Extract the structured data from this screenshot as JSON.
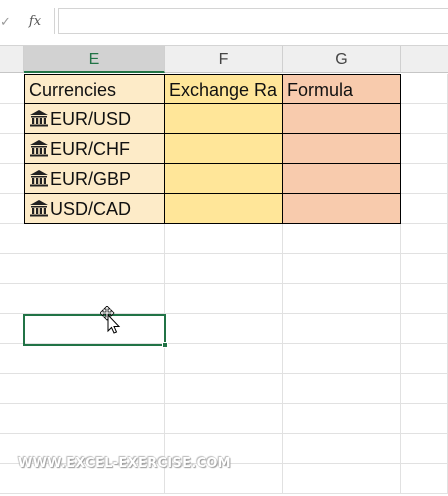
{
  "formula_bar": {
    "fx_label": "fx",
    "check_label": "✓",
    "value": ""
  },
  "columns": [
    "E",
    "F",
    "G"
  ],
  "selected_column": "E",
  "table": {
    "headers": [
      "Currencies",
      "Exchange Ra",
      "Formula"
    ],
    "rows": [
      {
        "currency": "EUR/USD",
        "rate": "",
        "formula": ""
      },
      {
        "currency": "EUR/CHF",
        "rate": "",
        "formula": ""
      },
      {
        "currency": "EUR/GBP",
        "rate": "",
        "formula": ""
      },
      {
        "currency": "USD/CAD",
        "rate": "",
        "formula": ""
      }
    ]
  },
  "icons": {
    "currency_icon": "bank-building-icon",
    "cursor": "move-pointer-icon"
  },
  "colors": {
    "currency_fill": "#fdebc8",
    "rate_fill": "#ffe699",
    "formula_fill": "#f8cbad",
    "selection_green": "#217346"
  },
  "watermark": "WWW.EXCEL-EXERCISE.COM"
}
